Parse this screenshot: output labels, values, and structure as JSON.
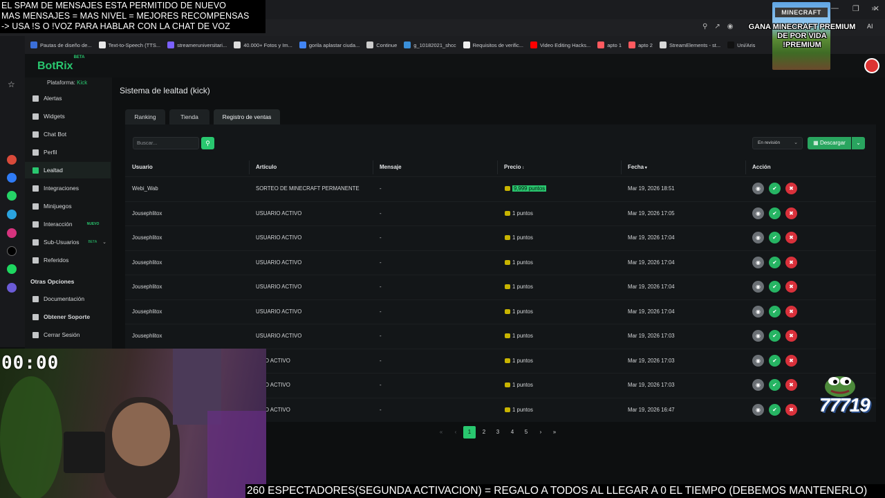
{
  "overlay": {
    "top_lines": [
      "EL SPAM DE MENSAJES ESTA PERMITIDO DE NUEVO",
      "MAS MENSAJES = MAS NIVEL = MEJORES RECOMPENSAS",
      "-> USA !S O !VOZ PARA HABLAR CON LA CHAT DE VOZ"
    ],
    "minecraft_logo": "MINECRAFT",
    "promo_lines": [
      "GANA MINECRAFT PREMIUM",
      "DE POR VIDA",
      "!PREMIUM"
    ],
    "timer": "00:00",
    "viewer_counter": "77719",
    "ticker": "260 ESPECTADORES(SEGUNDA ACTIVACION) = REGALO A TODOS AL LLEGAR A 0 EL TIEMPO (DEBEMOS MANTENERLO)"
  },
  "browser": {
    "ai_label": "AI",
    "bookmarks": [
      {
        "label": "Pautas de diseño de...",
        "color": "#3b6fd8"
      },
      {
        "label": "Text-to-Speech (TTS...",
        "color": "#e8e8e8"
      },
      {
        "label": "streameruniversitari...",
        "color": "#7b61ff"
      },
      {
        "label": "40.000+ Fotos y Im...",
        "color": "#dddddd"
      },
      {
        "label": "gorila aplastar ciuda...",
        "color": "#4285f4"
      },
      {
        "label": "Continue",
        "color": "#cccccc"
      },
      {
        "label": "g_10182021_shcc",
        "color": "#3a8fd9"
      },
      {
        "label": "Requisitos de verific...",
        "color": "#eeeeee"
      },
      {
        "label": "Video Editing Hacks...",
        "color": "#ff0000"
      },
      {
        "label": "apto 1",
        "color": "#ff5a5f"
      },
      {
        "label": "apto 2",
        "color": "#ff5a5f"
      },
      {
        "label": "StreamElements - st...",
        "color": "#d9d9d9"
      },
      {
        "label": "Uni/Aris",
        "color": "#111111"
      }
    ]
  },
  "app": {
    "logo": "BotRix",
    "logo_badge": "BETA",
    "platform_label": "Plataforma:",
    "platform_value": "Kick",
    "nav": [
      {
        "label": "Alertas"
      },
      {
        "label": "Widgets"
      },
      {
        "label": "Chat Bot"
      },
      {
        "label": "Perfil"
      },
      {
        "label": "Lealtad",
        "active": true
      },
      {
        "label": "Integraciones"
      },
      {
        "label": "Minijuegos"
      },
      {
        "label": "Interacción",
        "badge": "NUEVO"
      },
      {
        "label": "Sub-Usuarios",
        "badge": "BETA"
      },
      {
        "label": "Referidos"
      }
    ],
    "other_section": "Otras Opciones",
    "other": [
      {
        "label": "Documentación"
      },
      {
        "label": "Obtener Soporte"
      },
      {
        "label": "Cerrar Sesión"
      }
    ],
    "page_title": "Sistema de lealtad (kick)",
    "tabs": [
      {
        "label": "Ranking"
      },
      {
        "label": "Tienda"
      },
      {
        "label": "Registro de ventas",
        "active": true
      }
    ],
    "search_placeholder": "Buscar...",
    "filter_value": "En revisión",
    "download_label": "Descargar",
    "columns": [
      "Usuario",
      "Artículo",
      "Mensaje",
      "Precio",
      "Fecha",
      "Acción"
    ],
    "rows": [
      {
        "user": "Webi_Wab",
        "item": "SORTEO DE MINECRAFT PERMANENTE",
        "message": "-",
        "price": "9,999 puntos",
        "date": "Mar 19, 2026 18:51",
        "highlight": true
      },
      {
        "user": "Jousephlitox",
        "item": "USUARIO ACTIVO",
        "message": "-",
        "price": "1 puntos",
        "date": "Mar 19, 2026 17:05"
      },
      {
        "user": "Jousephlitox",
        "item": "USUARIO ACTIVO",
        "message": "-",
        "price": "1 puntos",
        "date": "Mar 19, 2026 17:04"
      },
      {
        "user": "Jousephlitox",
        "item": "USUARIO ACTIVO",
        "message": "-",
        "price": "1 puntos",
        "date": "Mar 19, 2026 17:04"
      },
      {
        "user": "Jousephlitox",
        "item": "USUARIO ACTIVO",
        "message": "-",
        "price": "1 puntos",
        "date": "Mar 19, 2026 17:04"
      },
      {
        "user": "Jousephlitox",
        "item": "USUARIO ACTIVO",
        "message": "-",
        "price": "1 puntos",
        "date": "Mar 19, 2026 17:04"
      },
      {
        "user": "Jousephlitox",
        "item": "USUARIO ACTIVO",
        "message": "-",
        "price": "1 puntos",
        "date": "Mar 19, 2026 17:03"
      },
      {
        "user": "",
        "item": "ARIO ACTIVO",
        "message": "-",
        "price": "1 puntos",
        "date": "Mar 19, 2026 17:03"
      },
      {
        "user": "",
        "item": "ARIO ACTIVO",
        "message": "-",
        "price": "1 puntos",
        "date": "Mar 19, 2026 17:03"
      },
      {
        "user": "",
        "item": "ARIO ACTIVO",
        "message": "-",
        "price": "1 puntos",
        "date": "Mar 19, 2026 16:47"
      }
    ],
    "pagination": {
      "first": "«",
      "prev": "‹",
      "pages": [
        "1",
        "2",
        "3",
        "4",
        "5"
      ],
      "current": "1",
      "next": "›",
      "last": "»"
    }
  },
  "colors": {
    "accent": "#29c76f",
    "danger": "#d9313b",
    "view": "#6b7075"
  }
}
